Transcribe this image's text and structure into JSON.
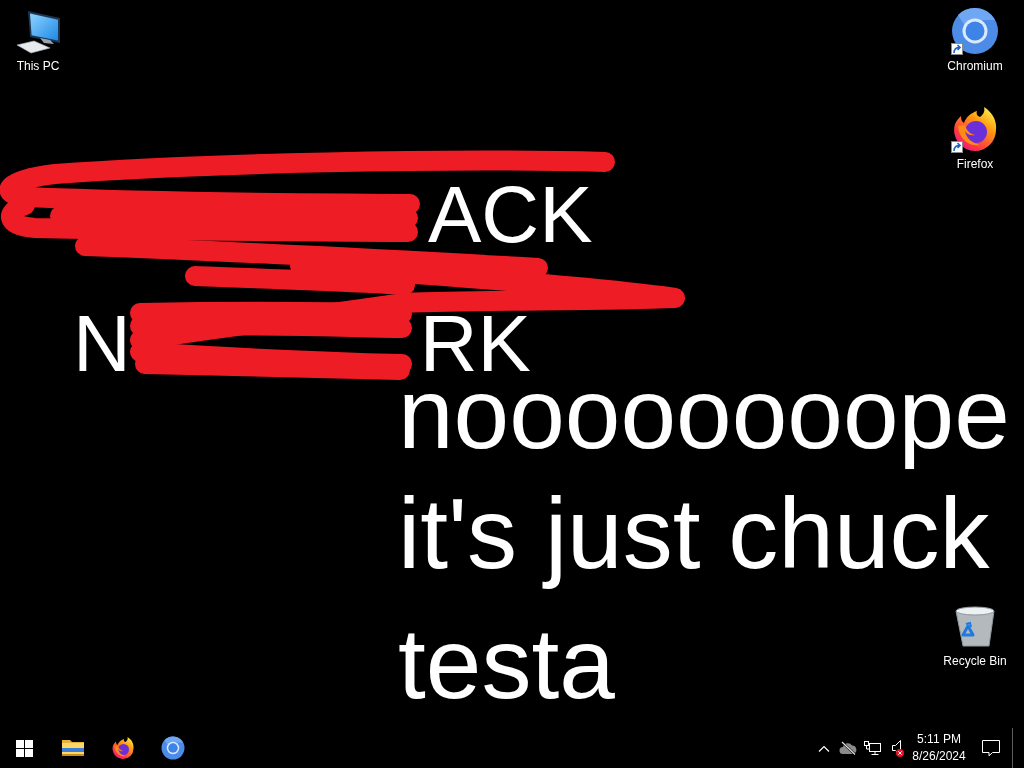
{
  "desktop": {
    "wallpaper": {
      "scribbled_lines": [
        {
          "visible_parts": [
            "ACK"
          ]
        },
        {
          "visible_parts": [
            "N",
            "RK"
          ]
        }
      ],
      "lines": [
        "noooooooope",
        "it's just chuck",
        "testa"
      ]
    },
    "icons_top_left": [
      {
        "label": "This PC",
        "kind": "computer",
        "shortcut": false
      }
    ],
    "icons_top_right": [
      {
        "label": "Chromium",
        "kind": "chromium",
        "shortcut": true
      },
      {
        "label": "Firefox",
        "kind": "firefox",
        "shortcut": true
      }
    ],
    "icons_bottom_right": [
      {
        "label": "Recycle Bin",
        "kind": "recycle-bin",
        "shortcut": false
      }
    ]
  },
  "taskbar": {
    "pinned": [
      {
        "kind": "file-explorer"
      },
      {
        "kind": "firefox"
      },
      {
        "kind": "chromium"
      }
    ],
    "tray": {
      "volume_muted": true,
      "time": "5:11 PM",
      "date": "8/26/2024"
    }
  }
}
